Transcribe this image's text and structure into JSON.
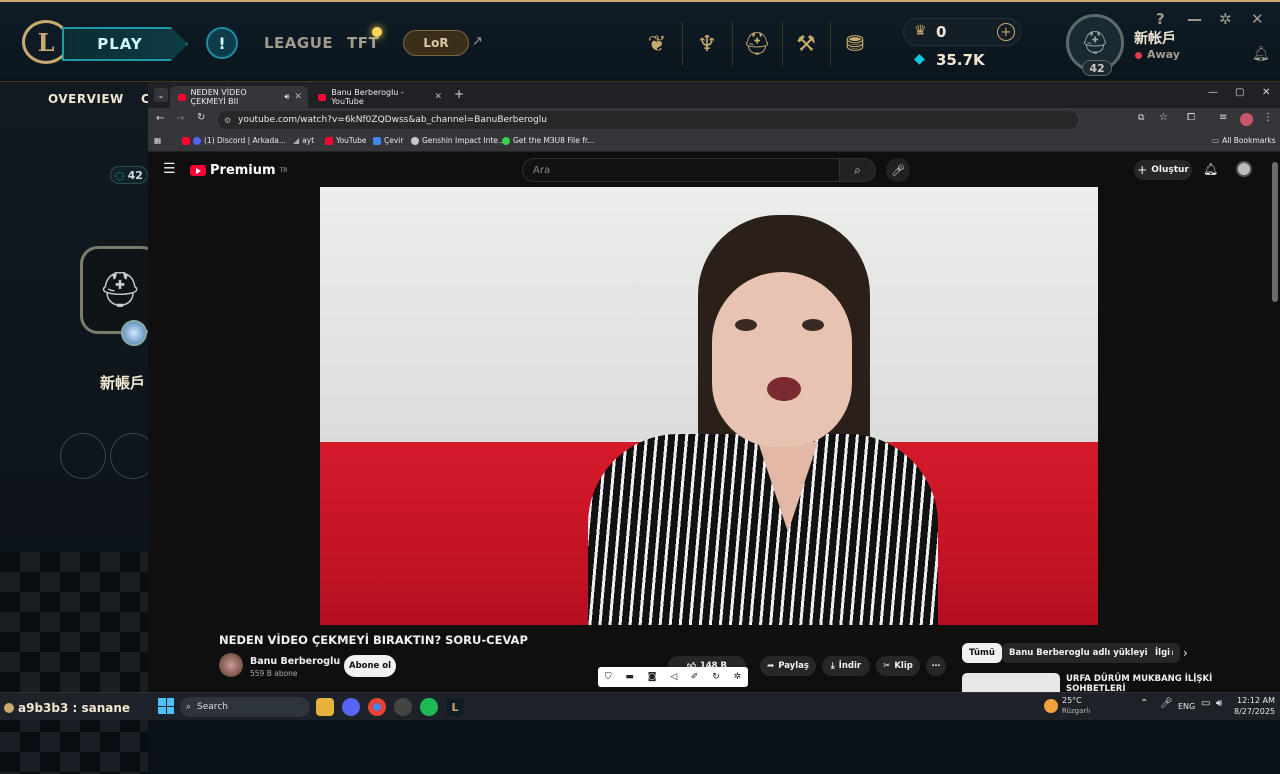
{
  "lol": {
    "logo": "L",
    "play_label": "PLAY",
    "alert_icon": "!",
    "nav": [
      "LEAGUE",
      "TFT"
    ],
    "lor_label": "LoR",
    "lor_arrow": "↗",
    "rp_value": "0",
    "be_value": "35.7K",
    "summoner_name": "新帐戶",
    "status": "Away",
    "level": "42",
    "left_tabs": [
      "OVERVIEW",
      "C"
    ],
    "left_level": "42",
    "left_name": "新帳戶",
    "chat_user": "a9b3b3 : sanane",
    "help_icon": "?",
    "min_icon": "—",
    "settings_icon": "✲",
    "close_icon": "✕",
    "plus_icon": "+"
  },
  "chrome": {
    "tabs": [
      {
        "title": "NEDEN VİDEO ÇEKMEYİ BII",
        "active": true
      },
      {
        "title": "Banu Berberoglu - YouTube",
        "active": false
      }
    ],
    "new_tab": "+",
    "url": "youtube.com/watch?v=6kNf0ZQDwss&ab_channel=BanuBerberoglu",
    "bookmarks": [
      "(1) Discord | Arkada...",
      "ayt",
      "YouTube",
      "Çevir",
      "Genshin Impact Inte...",
      "Get the M3U8 File fr..."
    ],
    "all_bookmarks": "All Bookmarks",
    "win_min": "—",
    "win_max": "▢",
    "win_close": "✕"
  },
  "youtube": {
    "logo_text": "Premium",
    "logo_sup": "TR",
    "search_placeholder": "Ara",
    "create_label": "Oluştur",
    "video_title": "NEDEN VİDEO ÇEKMEYİ BIRAKTIN? SORU-CEVAP",
    "channel_name": "Banu Berberoglu",
    "channel_subs": "559 B abone",
    "subscribe_label": "Abone ol",
    "likes": "148 B",
    "share_label": "Paylaş",
    "download_label": "İndir",
    "clip_label": "Klip",
    "chips": [
      "Tümü",
      "Banu Berberoglu adlı yükleyiciden",
      "İlgi"
    ],
    "rec_title": "URFA DÜRÜM MUKBANG İLİŞKİ SOHBETLERİ"
  },
  "taskbar": {
    "search_label": "Search",
    "weather_temp": "25°C",
    "weather_desc": "Rüzgarlı",
    "lang": "ENG",
    "time": "12:12 AM",
    "date": "8/27/2025"
  }
}
